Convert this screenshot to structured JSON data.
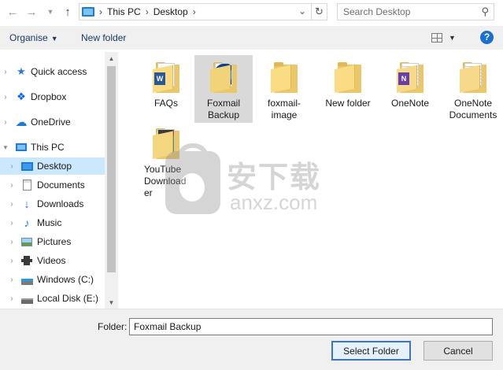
{
  "nav": {
    "back_icon": "left-arrow",
    "forward_icon": "right-arrow",
    "recent_icon": "chevron-down",
    "up_icon": "up-arrow"
  },
  "address": {
    "crumbs": [
      "This PC",
      "Desktop"
    ]
  },
  "search": {
    "placeholder": "Search Desktop"
  },
  "toolbar": {
    "organise_label": "Organise",
    "new_folder_label": "New folder",
    "help_label": "?"
  },
  "sidebar": {
    "items": [
      {
        "label": "Quick access",
        "icon": "star-icon"
      },
      {
        "label": "Dropbox",
        "icon": "dropbox-icon"
      },
      {
        "label": "OneDrive",
        "icon": "cloud-icon"
      },
      {
        "label": "This PC",
        "icon": "computer-icon"
      },
      {
        "label": "Desktop",
        "icon": "desktop-icon"
      },
      {
        "label": "Documents",
        "icon": "documents-icon"
      },
      {
        "label": "Downloads",
        "icon": "download-icon"
      },
      {
        "label": "Music",
        "icon": "music-icon"
      },
      {
        "label": "Pictures",
        "icon": "pictures-icon"
      },
      {
        "label": "Videos",
        "icon": "videos-icon"
      },
      {
        "label": "Windows (C:)",
        "icon": "drive-icon"
      },
      {
        "label": "Local Disk (E:)",
        "icon": "drive-icon"
      }
    ]
  },
  "files": [
    {
      "label": "FAQs",
      "icon": "word-folder-icon"
    },
    {
      "label": "Foxmail Backup",
      "icon": "foxmail-folder-icon"
    },
    {
      "label": "foxmail-image",
      "icon": "folder-icon"
    },
    {
      "label": "New folder",
      "icon": "folder-icon"
    },
    {
      "label": "OneNote",
      "icon": "onenote-folder-icon"
    },
    {
      "label": "OneNote Documents",
      "icon": "onenote-folder-icon"
    },
    {
      "label": "YouTube Downloader",
      "icon": "video-folder-icon"
    }
  ],
  "footer": {
    "folder_label": "Folder:",
    "folder_value": "Foxmail Backup",
    "select_label": "Select Folder",
    "cancel_label": "Cancel"
  },
  "colors": {
    "accent": "#1a6fd0",
    "selection": "#cce8ff",
    "folder": "#f9dc84"
  },
  "watermark": {
    "cn_text": "安下载",
    "en_text": "anxz.com"
  }
}
